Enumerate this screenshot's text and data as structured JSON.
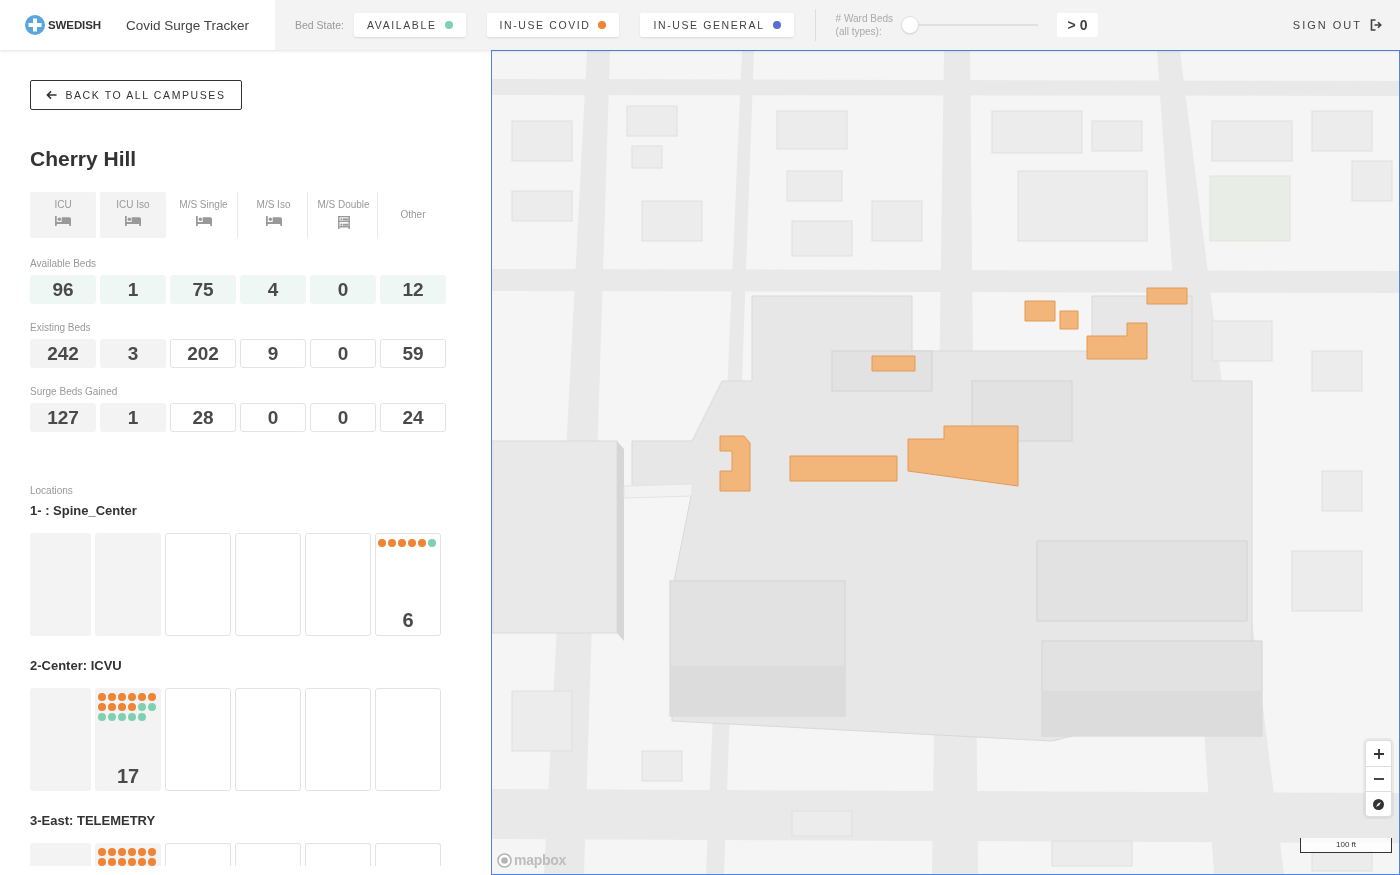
{
  "header": {
    "logo": "SWEDISH",
    "title": "Covid Surge Tracker",
    "bed_state_label": "Bed State:",
    "bed_states": [
      {
        "label": "AVAILABLE",
        "color": "#7fcfb1"
      },
      {
        "label": "IN-USE COVID",
        "color": "#ee8434"
      },
      {
        "label": "IN-USE GENERAL",
        "color": "#5b6fd3"
      }
    ],
    "ward_beds_filter": {
      "label": "# Ward Beds (all types):",
      "level": 0,
      "value": "> 0"
    },
    "sign_out": "SIGN OUT"
  },
  "sidebar": {
    "back_button": "BACK TO ALL CAMPUSES",
    "campus": "Cherry Hill",
    "bed_types": [
      {
        "label": "ICU",
        "kind": "icu"
      },
      {
        "label": "ICU Iso",
        "kind": "icu"
      },
      {
        "label": "M/S Single",
        "kind": "ward"
      },
      {
        "label": "M/S Iso",
        "kind": "ward"
      },
      {
        "label": "M/S Double",
        "kind": "double"
      },
      {
        "label": "Other",
        "kind": "other"
      }
    ],
    "bed_rows": [
      {
        "label": "Available Beds",
        "kind": "available",
        "values": [
          "96",
          "1",
          "75",
          "4",
          "0",
          "12"
        ]
      },
      {
        "label": "Existing Beds",
        "kind": "count",
        "values": [
          "242",
          "3",
          "202",
          "9",
          "0",
          "59"
        ]
      },
      {
        "label": "Surge Beds Gained",
        "kind": "count",
        "values": [
          "127",
          "1",
          "28",
          "0",
          "0",
          "24"
        ]
      }
    ],
    "locations_label": "Locations",
    "locations": [
      {
        "name": "1- : Spine_Center",
        "cells": [
          {},
          {},
          {},
          {},
          {},
          {
            "dots": [
              {
                "color": "#ee8434"
              },
              {
                "color": "#ee8434"
              },
              {
                "color": "#ee8434"
              },
              {
                "color": "#ee8434"
              },
              {
                "color": "#ee8434"
              },
              {
                "color": "#7fcfb1"
              }
            ],
            "count": "6"
          }
        ]
      },
      {
        "name": "2-Center: ICVU",
        "cells": [
          {},
          {
            "dots": [
              {
                "color": "#ee8434"
              },
              {
                "color": "#ee8434"
              },
              {
                "color": "#ee8434"
              },
              {
                "color": "#ee8434"
              },
              {
                "color": "#ee8434"
              },
              {
                "color": "#ee8434"
              },
              {
                "color": "#ee8434"
              },
              {
                "color": "#ee8434"
              },
              {
                "color": "#ee8434"
              },
              {
                "color": "#ee8434"
              },
              {
                "color": "#7fcfb1"
              },
              {
                "color": "#7fcfb1"
              },
              {
                "color": "#7fcfb1"
              },
              {
                "color": "#7fcfb1"
              },
              {
                "color": "#7fcfb1"
              },
              {
                "color": "#7fcfb1"
              },
              {
                "color": "#7fcfb1"
              }
            ],
            "count": "17"
          },
          {},
          {},
          {},
          {}
        ]
      },
      {
        "name": "3-East: TELEMETRY",
        "cells": [
          {},
          {
            "dots": [
              {
                "color": "#ee8434"
              },
              {
                "color": "#ee8434"
              },
              {
                "color": "#ee8434"
              },
              {
                "color": "#ee8434"
              },
              {
                "color": "#ee8434"
              },
              {
                "color": "#ee8434"
              },
              {
                "color": "#ee8434"
              },
              {
                "color": "#ee8434"
              },
              {
                "color": "#ee8434"
              },
              {
                "color": "#ee8434"
              },
              {
                "color": "#ee8434"
              },
              {
                "color": "#ee8434"
              }
            ]
          },
          {},
          {},
          {},
          {}
        ]
      }
    ]
  },
  "map": {
    "scale": "100 ft",
    "attribution": "mapbox"
  }
}
